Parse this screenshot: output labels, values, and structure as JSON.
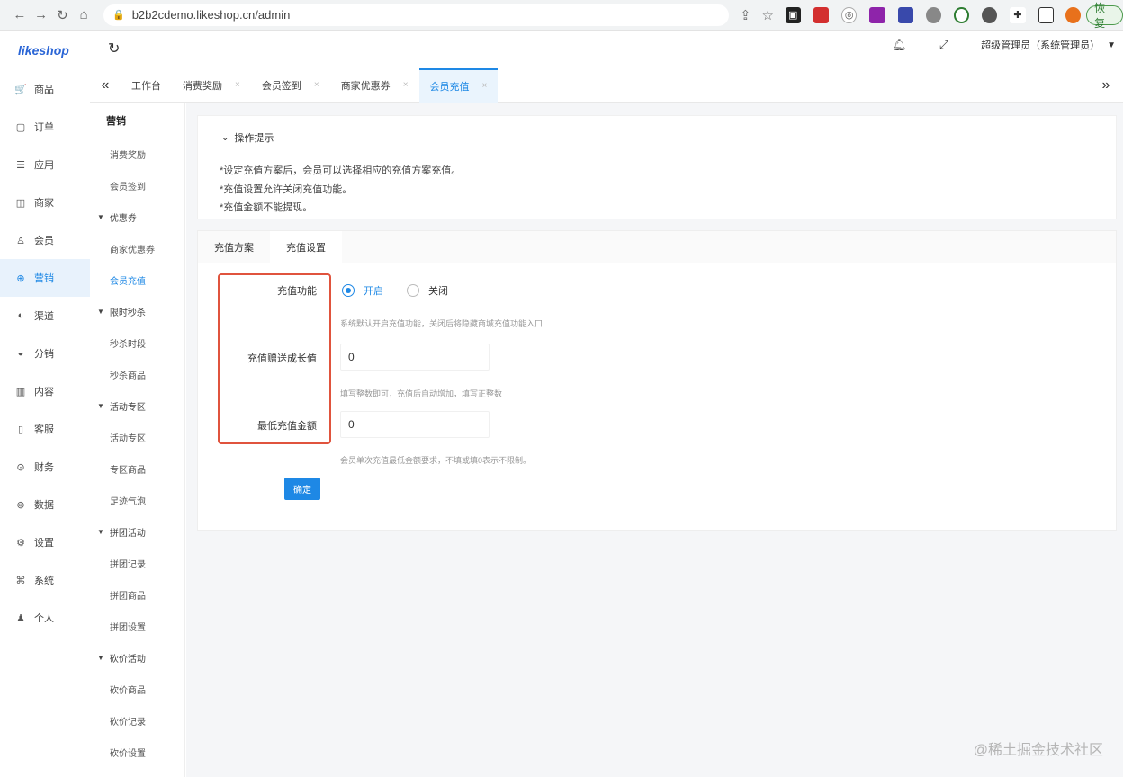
{
  "browser": {
    "url": "b2b2cdemo.likeshop.cn/admin",
    "restore_label": "恢复"
  },
  "app": {
    "logo": "likeshop",
    "admin_name": "超级管理员（系统管理员）"
  },
  "main_nav": [
    {
      "label": "商品",
      "icon": "cart-icon",
      "glyph": "🛒"
    },
    {
      "label": "订单",
      "icon": "order-icon",
      "glyph": "▢"
    },
    {
      "label": "应用",
      "icon": "app-icon",
      "glyph": "☰"
    },
    {
      "label": "商家",
      "icon": "shop-icon",
      "glyph": "◫"
    },
    {
      "label": "会员",
      "icon": "user-icon",
      "glyph": "♙"
    },
    {
      "label": "营销",
      "icon": "marketing-icon",
      "glyph": "⊕"
    },
    {
      "label": "渠道",
      "icon": "channel-icon",
      "glyph": "◐"
    },
    {
      "label": "分销",
      "icon": "distribution-icon",
      "glyph": "◒"
    },
    {
      "label": "内容",
      "icon": "content-icon",
      "glyph": "▥"
    },
    {
      "label": "客服",
      "icon": "service-icon",
      "glyph": "▯"
    },
    {
      "label": "财务",
      "icon": "finance-icon",
      "glyph": "⊙"
    },
    {
      "label": "数据",
      "icon": "data-icon",
      "glyph": "⊛"
    },
    {
      "label": "设置",
      "icon": "settings-icon",
      "glyph": "⚙"
    },
    {
      "label": "系统",
      "icon": "system-icon",
      "glyph": "⌘"
    },
    {
      "label": "个人",
      "icon": "person-icon",
      "glyph": "♟"
    }
  ],
  "tabs": [
    {
      "label": "工作台",
      "closable": false
    },
    {
      "label": "消费奖励",
      "closable": true
    },
    {
      "label": "会员签到",
      "closable": true
    },
    {
      "label": "商家优惠券",
      "closable": true
    },
    {
      "label": "会员充值",
      "closable": true
    }
  ],
  "sub_nav": {
    "title": "营销",
    "items": [
      {
        "type": "item",
        "label": "消费奖励"
      },
      {
        "type": "item",
        "label": "会员签到"
      },
      {
        "type": "group",
        "label": "优惠券"
      },
      {
        "type": "item",
        "label": "商家优惠券"
      },
      {
        "type": "item",
        "label": "会员充值",
        "active": true
      },
      {
        "type": "group",
        "label": "限时秒杀"
      },
      {
        "type": "item",
        "label": "秒杀时段"
      },
      {
        "type": "item",
        "label": "秒杀商品"
      },
      {
        "type": "group",
        "label": "活动专区"
      },
      {
        "type": "item",
        "label": "活动专区"
      },
      {
        "type": "item",
        "label": "专区商品"
      },
      {
        "type": "item",
        "label": "足迹气泡"
      },
      {
        "type": "group",
        "label": "拼团活动"
      },
      {
        "type": "item",
        "label": "拼团记录"
      },
      {
        "type": "item",
        "label": "拼团商品"
      },
      {
        "type": "item",
        "label": "拼团设置"
      },
      {
        "type": "group",
        "label": "砍价活动"
      },
      {
        "type": "item",
        "label": "砍价商品"
      },
      {
        "type": "item",
        "label": "砍价记录"
      },
      {
        "type": "item",
        "label": "砍价设置"
      }
    ]
  },
  "tips": {
    "title": "操作提示",
    "lines": [
      "*设定充值方案后，会员可以选择相应的充值方案充值。",
      "*充值设置允许关闭充值功能。",
      "*充值金额不能提现。"
    ]
  },
  "form": {
    "tabs": [
      "充值方案",
      "充值设置"
    ],
    "recharge_function": {
      "label": "充值功能",
      "options": [
        "开启",
        "关闭"
      ],
      "selected": "开启",
      "hint": "系统默认开启充值功能，关闭后将隐藏商城充值功能入口"
    },
    "growth_value": {
      "label": "充值赠送成长值",
      "value": "0",
      "hint": "填写整数即可，充值后自动增加，填写正整数"
    },
    "min_amount": {
      "label": "最低充值金额",
      "value": "0",
      "hint": "会员单次充值最低金额要求，不填或填0表示不限制。"
    },
    "confirm_label": "确定"
  },
  "watermark": "@稀土掘金技术社区"
}
